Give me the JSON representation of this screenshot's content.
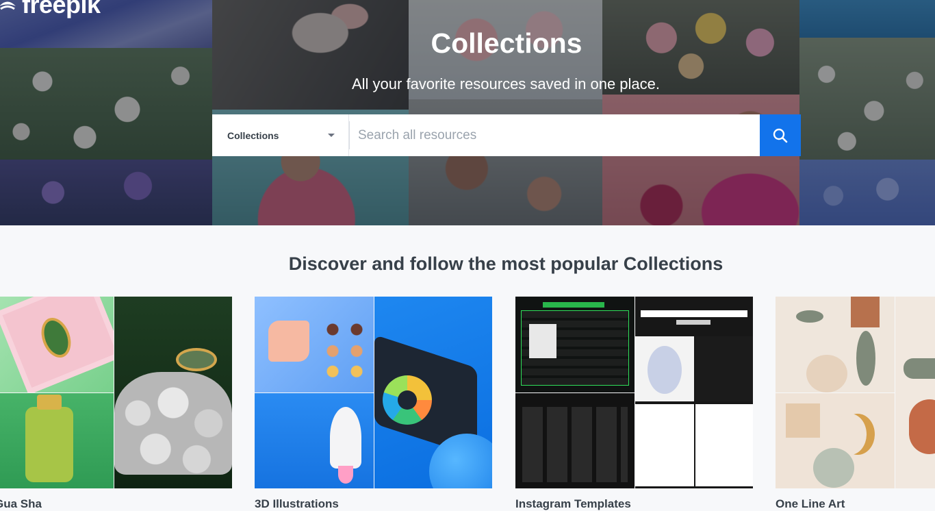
{
  "brand": {
    "logo_text": "freepik"
  },
  "hero": {
    "title": "Collections",
    "subtitle": "All your favorite resources saved in one place."
  },
  "search": {
    "category": "Collections",
    "placeholder": "Search all resources"
  },
  "section": {
    "title": "Discover and follow the most popular Collections"
  },
  "collections": [
    {
      "label": "Gua Sha"
    },
    {
      "label": "3D Illustrations"
    },
    {
      "label": "Instagram Templates"
    },
    {
      "label": "One Line Art"
    }
  ],
  "colors": {
    "accent": "#1273eb",
    "text_dark": "#374049",
    "page_bg": "#f7f8fa"
  },
  "icons": {
    "search": "search-icon",
    "dropdown": "chevron-down-icon",
    "logo": "freepik-logo"
  }
}
